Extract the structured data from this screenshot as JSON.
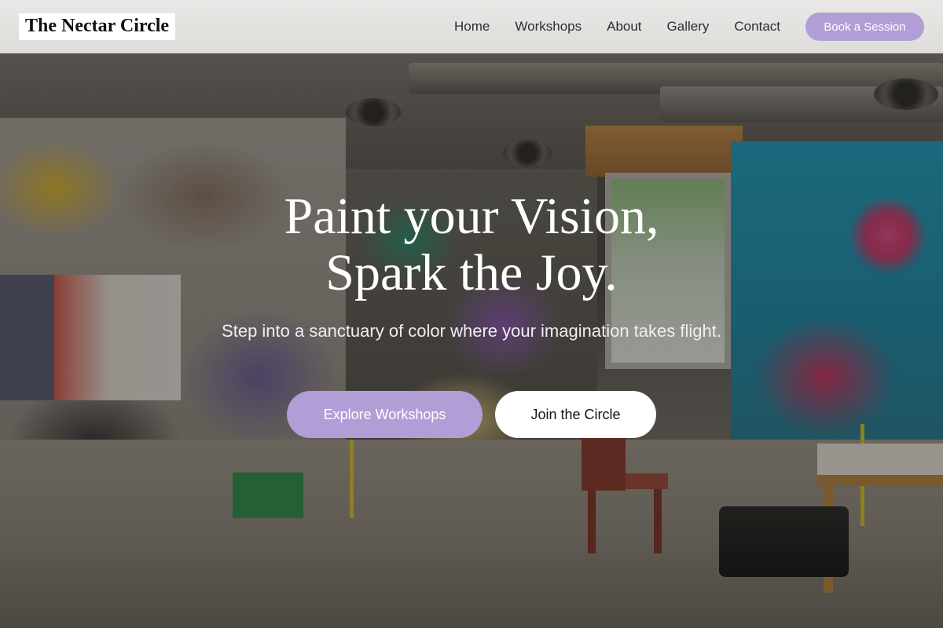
{
  "brand": {
    "name": "The Nectar Circle"
  },
  "nav": {
    "links": [
      "Home",
      "Workshops",
      "About",
      "Gallery",
      "Contact"
    ],
    "cta_label": "Book a Session"
  },
  "hero": {
    "headline_line1": "Paint your Vision,",
    "headline_line2": "Spark the Joy.",
    "subtext": "Step into a sanctuary of color where your imagination takes flight.",
    "primary_cta": "Explore Workshops",
    "secondary_cta": "Join the Circle",
    "background_image": "graffiti-art-studio-photo"
  },
  "colors": {
    "accent": "#b29ed6",
    "navbar_bg": "#e6e5e3",
    "text_dark": "#2d2d33"
  }
}
